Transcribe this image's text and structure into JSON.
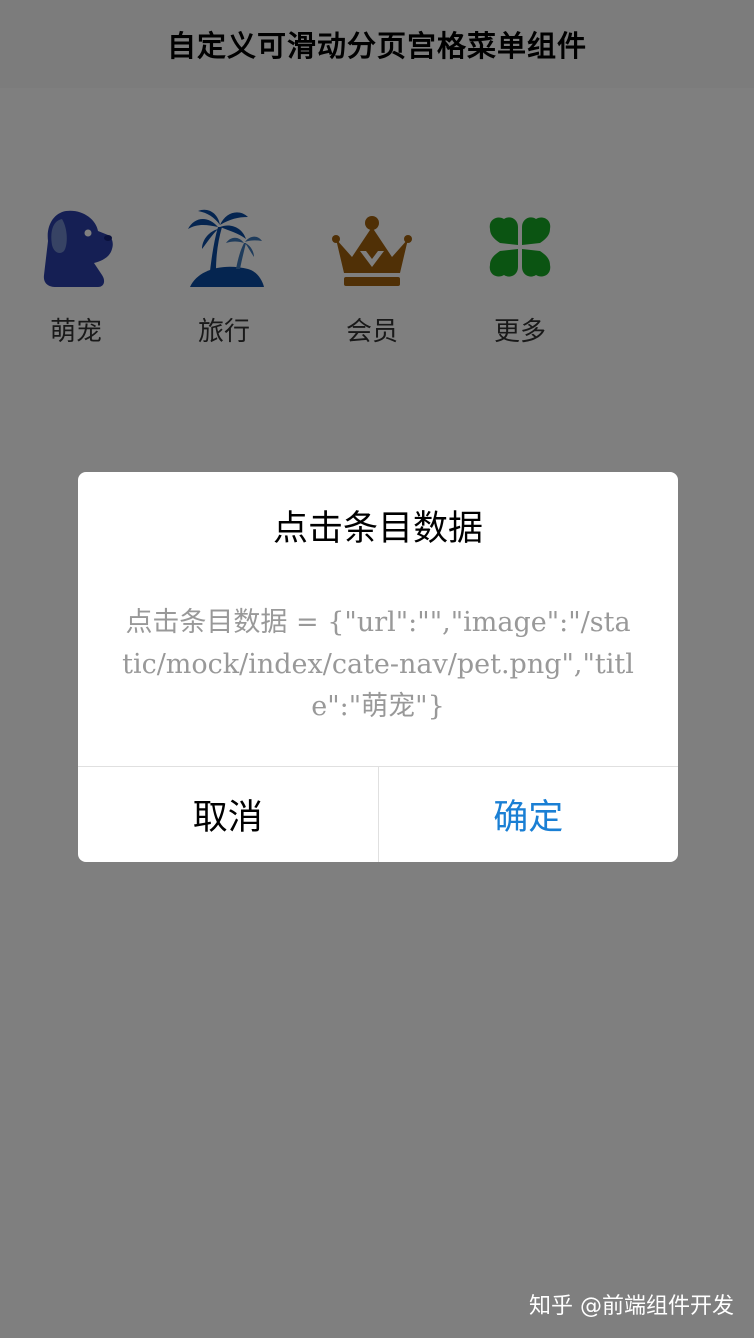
{
  "header": {
    "title": "自定义可滑动分页宫格菜单组件"
  },
  "grid": {
    "items": [
      {
        "label": "萌宠",
        "icon": "pet-dog-icon",
        "color": "#2b3fa8"
      },
      {
        "label": "旅行",
        "icon": "palm-tree-island-icon",
        "color": "#0b4aa0"
      },
      {
        "label": "会员",
        "icon": "crown-icon",
        "color": "#a0600c"
      },
      {
        "label": "更多",
        "icon": "clover-icon",
        "color": "#17a824"
      }
    ]
  },
  "modal": {
    "title": "点击条目数据",
    "content": "点击条目数据 = {\"url\":\"\",\"image\":\"/static/mock/index/cate-nav/pet.png\",\"title\":\"萌宠\"}",
    "cancel_label": "取消",
    "confirm_label": "确定",
    "confirm_color": "#1a7fd4"
  },
  "watermark": "知乎 @前端组件开发"
}
